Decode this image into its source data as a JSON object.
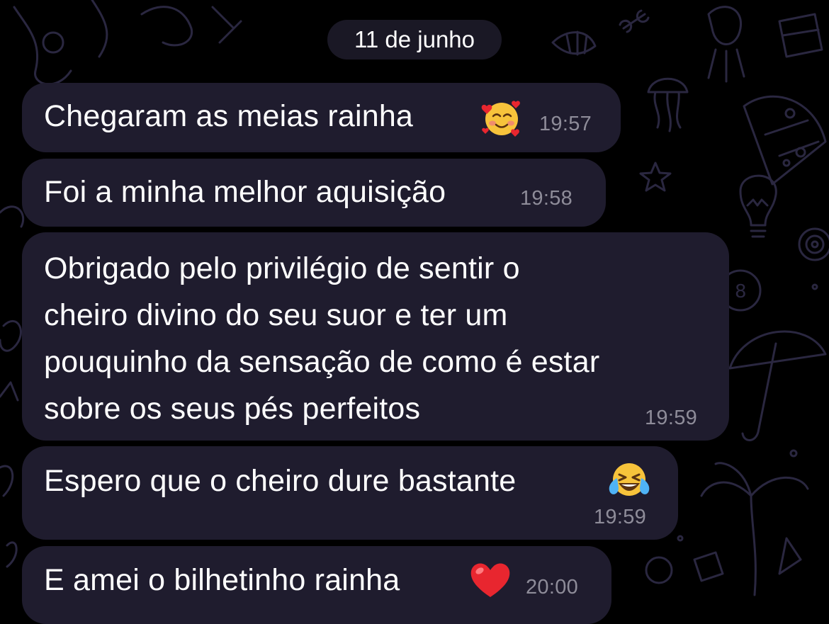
{
  "date_separator": "11 de junho",
  "messages": [
    {
      "text": "Chegaram as meias rainha",
      "emoji": "smiling-face-with-hearts",
      "time": "19:57"
    },
    {
      "text": "Foi a minha melhor aquisição",
      "emoji": "",
      "time": "19:58"
    },
    {
      "lines": [
        "Obrigado pelo privilégio de sentir o",
        "cheiro divino do seu suor e ter um",
        "pouquinho da sensação de como é estar",
        "sobre os seus pés perfeitos"
      ],
      "emoji": "",
      "time": "19:59"
    },
    {
      "text": "Espero que o cheiro dure bastante",
      "emoji": "face-with-tears-of-joy",
      "time": "19:59"
    },
    {
      "text": "E amei o bilhetinho rainha",
      "emoji": "red-heart",
      "time": "20:00"
    }
  ],
  "colors": {
    "background": "#000000",
    "bubble": "#1f1c2e",
    "text": "#ffffff",
    "timestamp": "#8e8c99",
    "wallpaper_doodle": "#2a2740"
  }
}
